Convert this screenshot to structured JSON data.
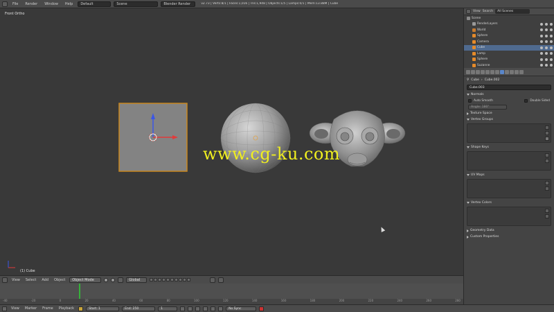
{
  "top_bar": {
    "menus": [
      "File",
      "Render",
      "Window",
      "Help"
    ],
    "layout": "Default",
    "scene": "Scene",
    "engine": "Blender Render",
    "stats": "v2.73 | Verts:8/1 | Faces:1,016 | Tris:1,948 | Objects:1/5 | Lamps:0/1 | Mem:13.88M | Cube"
  },
  "viewport": {
    "label": "Front Ortho",
    "object_label": "(1) Cube",
    "watermark": "www.cg-ku.com"
  },
  "view3d_header": {
    "menus": [
      "View",
      "Select",
      "Add",
      "Object"
    ],
    "mode": "Object Mode",
    "orientation": "Global"
  },
  "timeline": {
    "ticks": [
      "-40",
      "-20",
      "0",
      "20",
      "40",
      "60",
      "80",
      "100",
      "120",
      "140",
      "160",
      "180",
      "200",
      "220",
      "240",
      "260",
      "280"
    ],
    "header": {
      "menus": [
        "View",
        "Marker",
        "Frame",
        "Playback"
      ],
      "start": "Start:",
      "start_val": "1",
      "end": "End:",
      "end_val": "250",
      "current": "1",
      "sync": "No Sync"
    }
  },
  "outliner": {
    "header_menus": [
      "View",
      "Search"
    ],
    "filter": "All Scenes",
    "items": [
      {
        "name": "Scene",
        "icon_color": "#8a8a8a",
        "indent": 0
      },
      {
        "name": "RenderLayers",
        "icon_color": "#9a9a9a",
        "indent": 1
      },
      {
        "name": "World",
        "icon_color": "#c77b2f",
        "indent": 1
      },
      {
        "name": "Sphere",
        "icon_color": "#e58a2a",
        "indent": 1
      },
      {
        "name": "Camera",
        "icon_color": "#e58a2a",
        "indent": 1
      },
      {
        "name": "Cube",
        "icon_color": "#e58a2a",
        "indent": 1
      },
      {
        "name": "Lamp",
        "icon_color": "#e58a2a",
        "indent": 1
      },
      {
        "name": "Sphere",
        "icon_color": "#e58a2a",
        "indent": 1
      },
      {
        "name": "Suzanne",
        "icon_color": "#e58a2a",
        "indent": 1
      }
    ]
  },
  "properties": {
    "breadcrumb": [
      "Cube",
      "Cube.002"
    ],
    "mesh_name": "Cube.003",
    "panels": {
      "normals": "Normals",
      "auto_smooth": "Auto Smooth",
      "double_sided": "Double Sided",
      "angle": "Angle:",
      "angle_val": "180°",
      "texture_space": "Texture Space",
      "vertex_groups": "Vertex Groups",
      "shape_keys": "Shape Keys",
      "uv_maps": "UV Maps",
      "vertex_colors": "Vertex Colors",
      "geometry_data": "Geometry Data",
      "custom_properties": "Custom Properties"
    }
  },
  "colors": {
    "accent": "#5a86c9",
    "selection": "#e58a2a",
    "watermark": "#f0ef1f"
  }
}
